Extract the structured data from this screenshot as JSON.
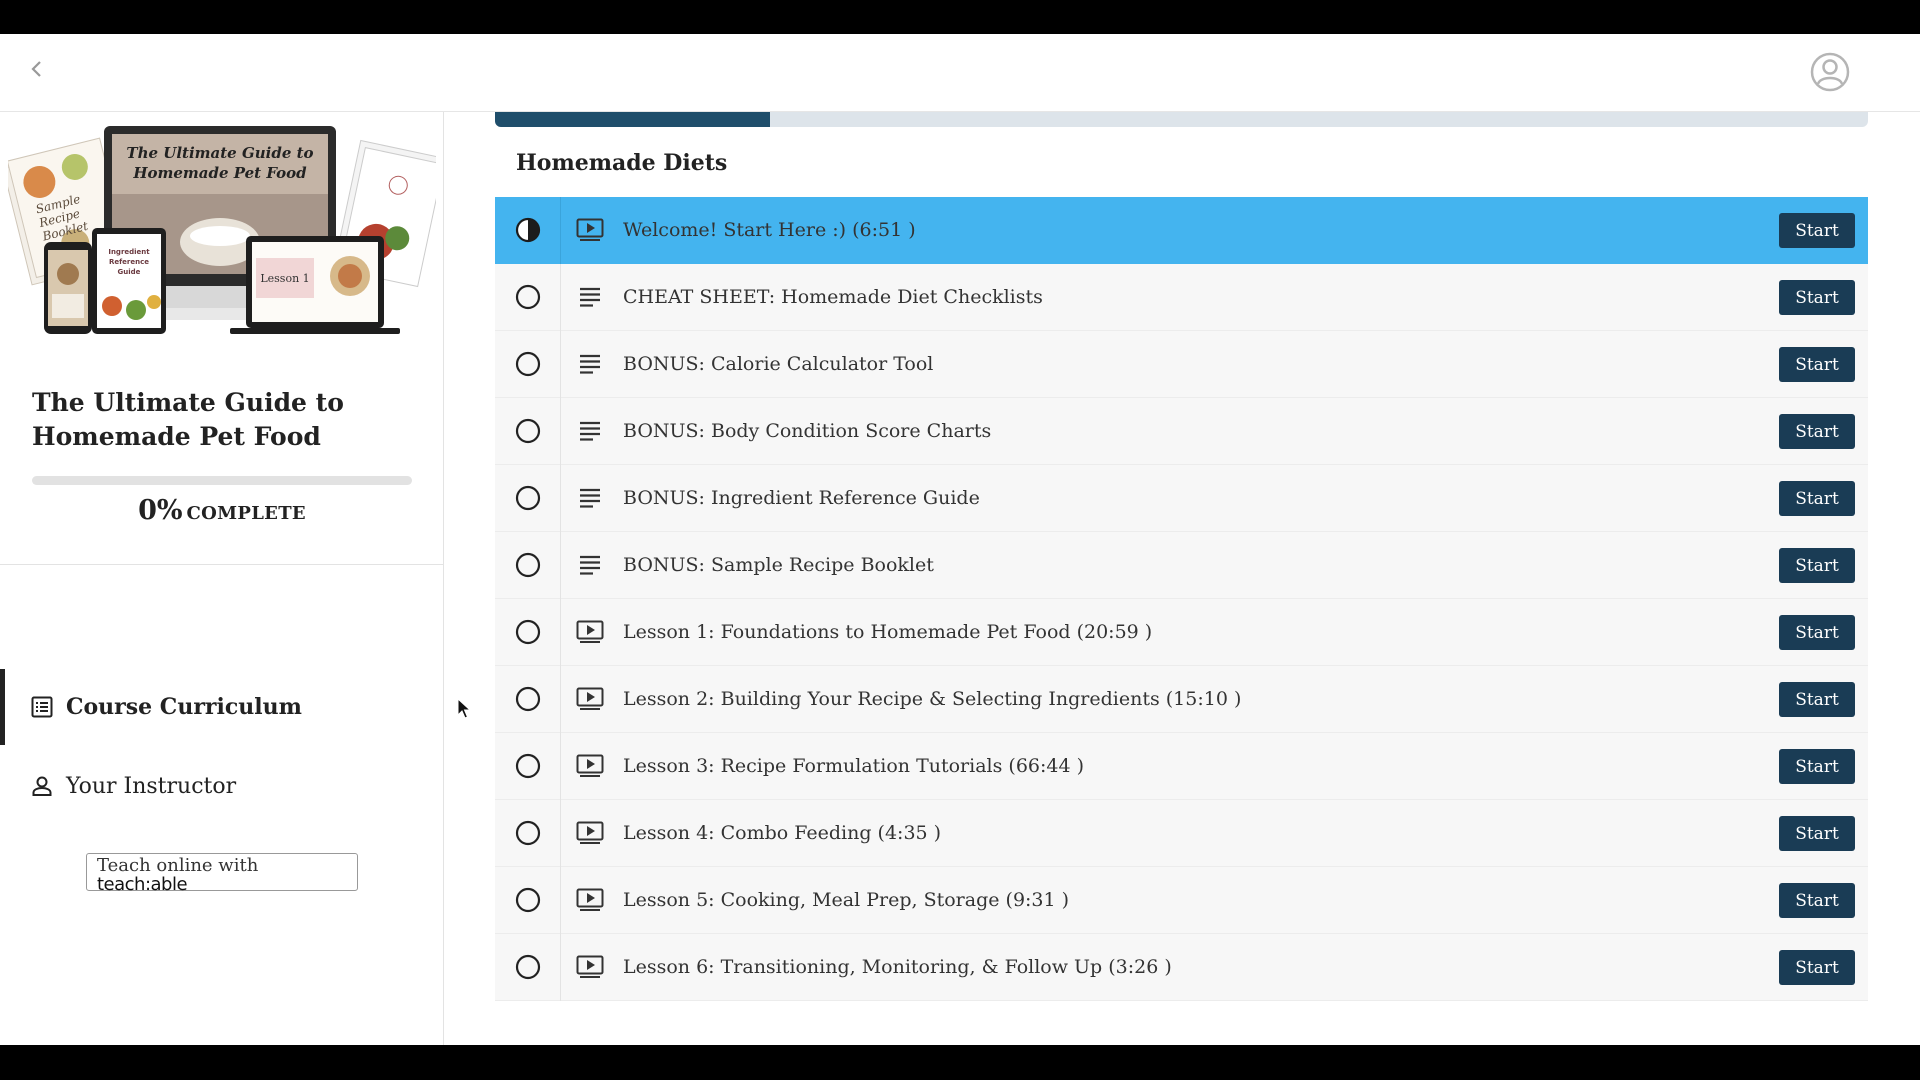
{
  "course": {
    "title": "The Ultimate Guide to Homemade Pet Food",
    "progress_value": 0,
    "progress_percent": "0%",
    "progress_label": "COMPLETE"
  },
  "cover_art": {
    "monitor_title": "The Ultimate Guide to Homemade Pet Food",
    "booklet_label": "Sample Recipe Booklet",
    "phone_label": "Ingredient Reference Guide",
    "laptop_label": "Lesson 1"
  },
  "nav": {
    "curriculum_label": "Course Curriculum",
    "instructor_label": "Your Instructor"
  },
  "badge": {
    "line1": "Teach online with",
    "line2": "teach:able"
  },
  "section": {
    "title": "Homemade Diets"
  },
  "lectures": [
    {
      "title": "Welcome! Start Here :) (6:51 )",
      "type": "video-icon",
      "status": "half-circle-icon",
      "button": "Start"
    },
    {
      "title": "CHEAT SHEET: Homemade Diet Checklists",
      "type": "text-lines-icon",
      "status": "circle-icon",
      "button": "Start"
    },
    {
      "title": "BONUS: Calorie Calculator Tool",
      "type": "text-lines-icon",
      "status": "circle-icon",
      "button": "Start"
    },
    {
      "title": "BONUS: Body Condition Score Charts",
      "type": "text-lines-icon",
      "status": "circle-icon",
      "button": "Start"
    },
    {
      "title": "BONUS: Ingredient Reference Guide",
      "type": "text-lines-icon",
      "status": "circle-icon",
      "button": "Start"
    },
    {
      "title": "BONUS: Sample Recipe Booklet",
      "type": "text-lines-icon",
      "status": "circle-icon",
      "button": "Start"
    },
    {
      "title": "Lesson 1: Foundations to Homemade Pet Food (20:59 )",
      "type": "video-icon",
      "status": "circle-icon",
      "button": "Start"
    },
    {
      "title": "Lesson 2: Building Your Recipe & Selecting Ingredients (15:10 )",
      "type": "video-icon",
      "status": "circle-icon",
      "button": "Start"
    },
    {
      "title": "Lesson 3: Recipe Formulation Tutorials (66:44 )",
      "type": "video-icon",
      "status": "circle-icon",
      "button": "Start"
    },
    {
      "title": "Lesson 4: Combo Feeding (4:35 )",
      "type": "video-icon",
      "status": "circle-icon",
      "button": "Start"
    },
    {
      "title": "Lesson 5: Cooking, Meal Prep, Storage (9:31 )",
      "type": "video-icon",
      "status": "circle-icon",
      "button": "Start"
    },
    {
      "title": "Lesson 6: Transitioning, Monitoring, & Follow Up (3:26 )",
      "type": "video-icon",
      "status": "circle-icon",
      "button": "Start"
    }
  ],
  "top_progress_value": 0.2,
  "colors": {
    "highlight_row": "#44b4ef",
    "button_bg": "#1a3c55",
    "progress_fill": "#1f4e6b",
    "row_bg": "#f7f7f7"
  },
  "icons": {
    "back": "chevron-left-icon",
    "avatar": "user-avatar-icon",
    "curriculum": "list-icon",
    "instructor": "person-icon"
  }
}
